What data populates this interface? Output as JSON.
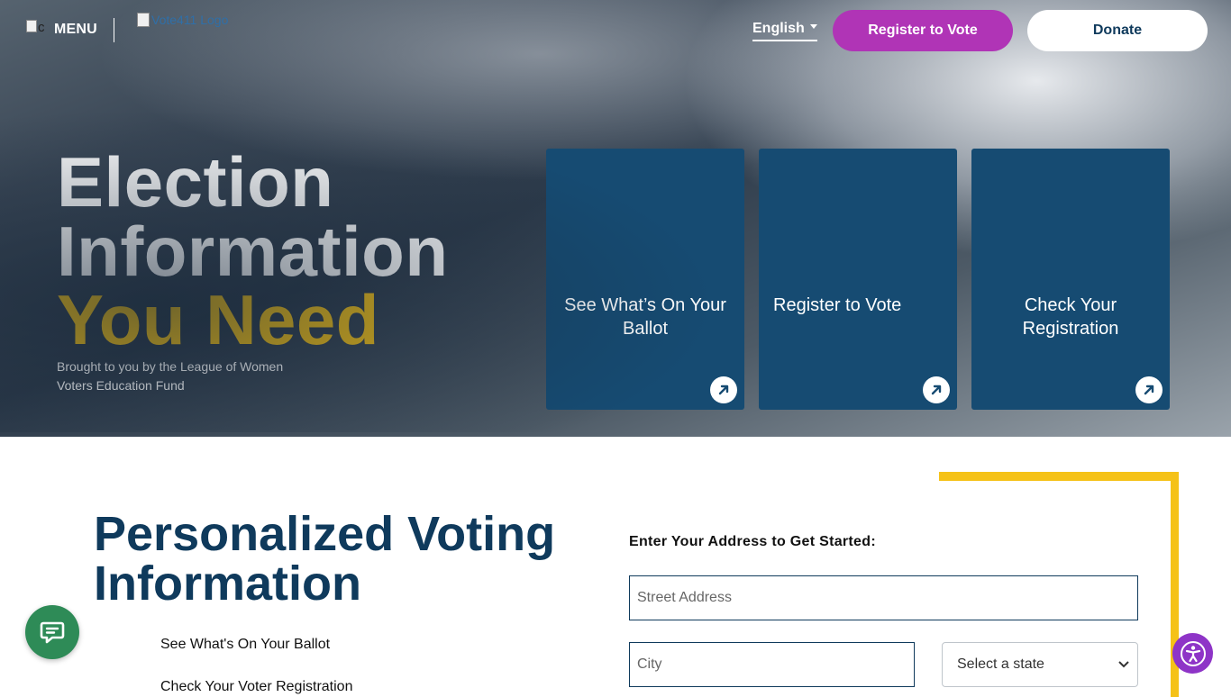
{
  "header": {
    "broken_icon_alt": "c",
    "menu_label": "MENU",
    "logo_alt": "Vote411 Logo",
    "language": "English",
    "register_label": "Register to Vote",
    "donate_label": "Donate"
  },
  "hero": {
    "title_line1": "Election",
    "title_line2": "Information",
    "title_line3": "You Need",
    "byline": "Brought to you by the League of Women Voters Education Fund",
    "cards": [
      {
        "label": "See What’s On Your Ballot",
        "icon": "arrow-up-right-icon"
      },
      {
        "label": "Register to Vote",
        "icon": "arrow-up-right-icon"
      },
      {
        "label": "Check Your Registration",
        "icon": "arrow-up-right-icon"
      }
    ]
  },
  "personalized": {
    "title_line1": "Personalized Voting",
    "title_line2": "Information",
    "links": [
      "See What's On Your Ballot",
      "Check Your Voter Registration"
    ]
  },
  "address_form": {
    "label": "Enter Your Address to Get Started:",
    "street_placeholder": "Street Address",
    "city_placeholder": "City",
    "state_selected": "Select a state"
  },
  "colors": {
    "accent_purple": "#b034b6",
    "accent_yellow": "#f5c218",
    "navy": "#0f3a5c",
    "card_blue": "#164b72",
    "chat_green": "#2e8b57",
    "a11y_purple": "#8e34c7"
  },
  "widgets": {
    "chat_icon": "chat-bubble-icon",
    "accessibility_icon": "accessibility-icon"
  }
}
